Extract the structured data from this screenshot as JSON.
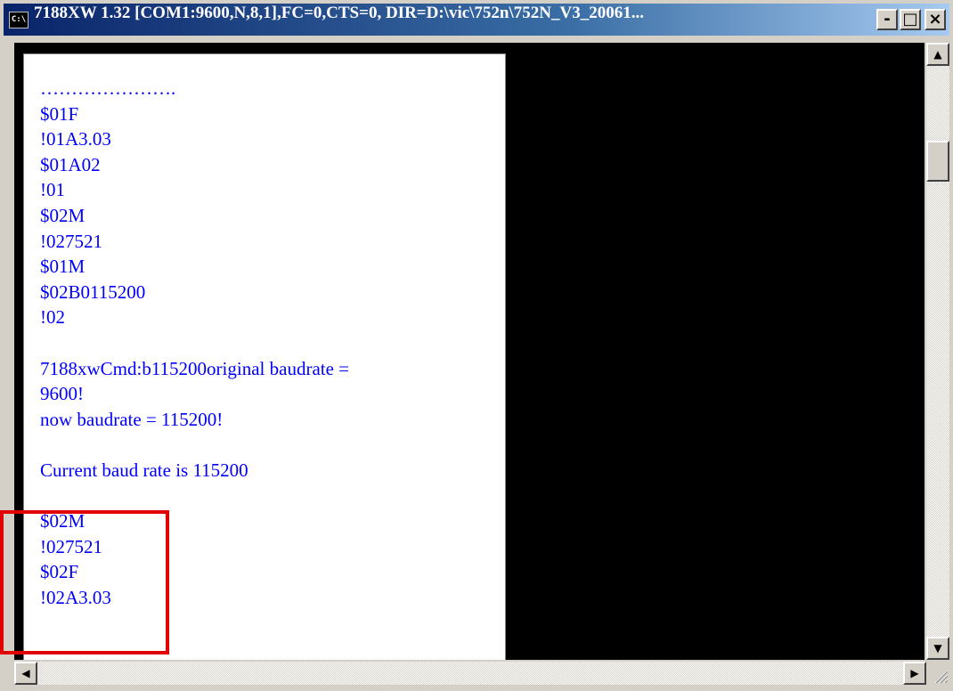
{
  "window": {
    "icon_text": "C:\\",
    "title": "7188XW 1.32 [COM1:9600,N,8,1],FC=0,CTS=0, DIR=D:\\vic\\752n\\752N_V3_20061...",
    "minimize": "-",
    "maximize": "□",
    "close": "×"
  },
  "console": {
    "lines": [
      "………………….",
      "$01F",
      "!01A3.03",
      "$01A02",
      "!01",
      "$02M",
      "!027521",
      "$01M",
      "$02B0115200",
      "!02",
      "",
      "7188xwCmd:b115200original baudrate =",
      "9600!",
      "now baudrate = 115200!",
      "",
      "Current baud rate is 115200",
      "",
      "$02M",
      "!027521",
      "$02F",
      "!02A3.03"
    ]
  },
  "scrollbars": {
    "up_arrow": "▲",
    "down_arrow": "▼",
    "left_arrow": "◀",
    "right_arrow": "▶"
  },
  "colors": {
    "title_bar": "#0a246a",
    "console_bg": "#000000",
    "text": "#0000ff",
    "highlight": "#e00000"
  }
}
